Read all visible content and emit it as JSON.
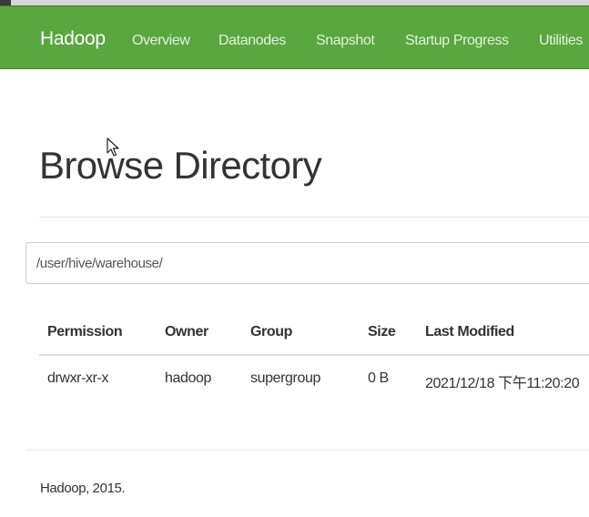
{
  "navbar": {
    "brand": "Hadoop",
    "items": [
      "Overview",
      "Datanodes",
      "Snapshot",
      "Startup Progress",
      "Utilities"
    ]
  },
  "page": {
    "title": "Browse Directory"
  },
  "path_input": {
    "value": "/user/hive/warehouse/"
  },
  "table": {
    "columns": [
      "Permission",
      "Owner",
      "Group",
      "Size",
      "Last Modified"
    ],
    "rows": [
      [
        "drwxr-xr-x",
        "hadoop",
        "supergroup",
        "0 B",
        "2021/12/18 下午11:20:20"
      ]
    ]
  },
  "footer": {
    "text": "Hadoop, 2015."
  },
  "colors": {
    "navbar_bg": "#5aa63f",
    "navbar_text": "#ffffff"
  }
}
